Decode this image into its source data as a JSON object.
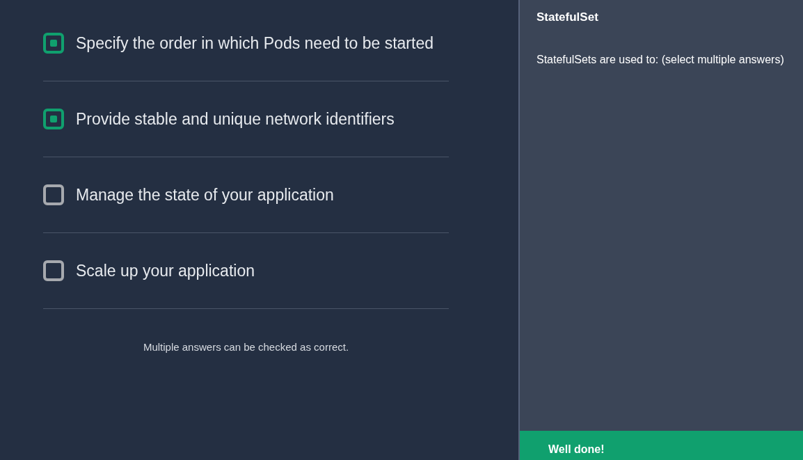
{
  "options": [
    {
      "label": "Specify the order in which Pods need to be started",
      "checked": true
    },
    {
      "label": "Provide stable and unique network identifiers",
      "checked": true
    },
    {
      "label": "Manage the state of your application",
      "checked": false
    },
    {
      "label": "Scale up your application",
      "checked": false
    }
  ],
  "note": "Multiple answers can be checked as correct.",
  "sidebar": {
    "title": "StatefulSet",
    "question": "StatefulSets are used to: (select multiple answers)"
  },
  "feedback": {
    "message": "Well done!"
  }
}
